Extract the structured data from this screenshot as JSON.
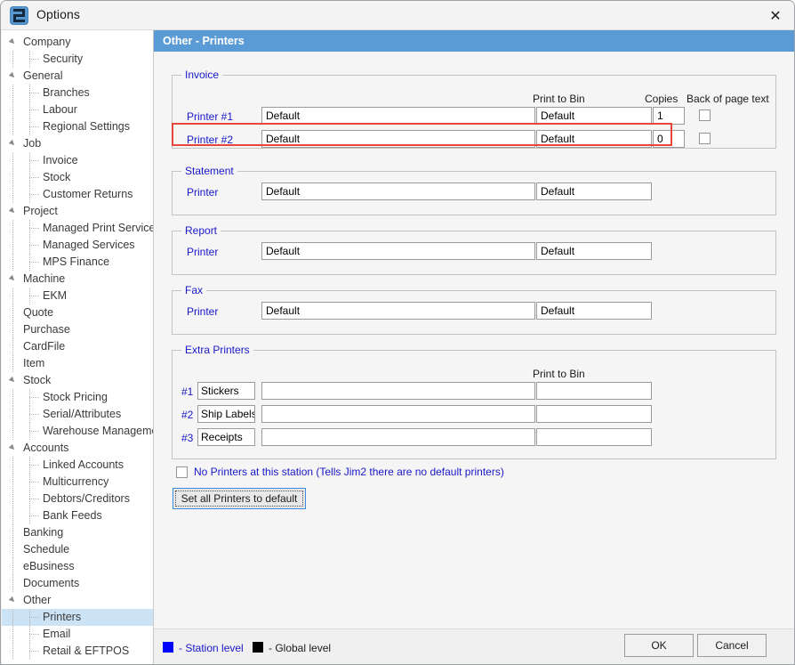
{
  "window": {
    "title": "Options",
    "app_icon": "jim2-logo-icon",
    "close_icon": "close-icon"
  },
  "page_header": {
    "title": "Other - Printers",
    "accent_color": "#5b9bd5"
  },
  "sidebar": {
    "items": [
      {
        "label": "Company",
        "level": 0,
        "expander": true,
        "selected": false
      },
      {
        "label": "Security",
        "level": 1,
        "expander": false,
        "selected": false
      },
      {
        "label": "General",
        "level": 0,
        "expander": true,
        "selected": false
      },
      {
        "label": "Branches",
        "level": 1,
        "expander": false,
        "selected": false
      },
      {
        "label": "Labour",
        "level": 1,
        "expander": false,
        "selected": false
      },
      {
        "label": "Regional Settings",
        "level": 1,
        "expander": false,
        "selected": false
      },
      {
        "label": "Job",
        "level": 0,
        "expander": true,
        "selected": false
      },
      {
        "label": "Invoice",
        "level": 1,
        "expander": false,
        "selected": false
      },
      {
        "label": "Stock",
        "level": 1,
        "expander": false,
        "selected": false
      },
      {
        "label": "Customer Returns",
        "level": 1,
        "expander": false,
        "selected": false
      },
      {
        "label": "Project",
        "level": 0,
        "expander": true,
        "selected": false
      },
      {
        "label": "Managed Print Services",
        "level": 1,
        "expander": false,
        "selected": false
      },
      {
        "label": "Managed Services",
        "level": 1,
        "expander": false,
        "selected": false
      },
      {
        "label": "MPS Finance",
        "level": 1,
        "expander": false,
        "selected": false
      },
      {
        "label": "Machine",
        "level": 0,
        "expander": true,
        "selected": false
      },
      {
        "label": "EKM",
        "level": 1,
        "expander": false,
        "selected": false
      },
      {
        "label": "Quote",
        "level": 0,
        "expander": false,
        "selected": false
      },
      {
        "label": "Purchase",
        "level": 0,
        "expander": false,
        "selected": false
      },
      {
        "label": "CardFile",
        "level": 0,
        "expander": false,
        "selected": false
      },
      {
        "label": "Item",
        "level": 0,
        "expander": false,
        "selected": false
      },
      {
        "label": "Stock",
        "level": 0,
        "expander": true,
        "selected": false
      },
      {
        "label": "Stock Pricing",
        "level": 1,
        "expander": false,
        "selected": false
      },
      {
        "label": "Serial/Attributes",
        "level": 1,
        "expander": false,
        "selected": false
      },
      {
        "label": "Warehouse Management",
        "level": 1,
        "expander": false,
        "selected": false
      },
      {
        "label": "Accounts",
        "level": 0,
        "expander": true,
        "selected": false
      },
      {
        "label": "Linked Accounts",
        "level": 1,
        "expander": false,
        "selected": false
      },
      {
        "label": "Multicurrency",
        "level": 1,
        "expander": false,
        "selected": false
      },
      {
        "label": "Debtors/Creditors",
        "level": 1,
        "expander": false,
        "selected": false
      },
      {
        "label": "Bank Feeds",
        "level": 1,
        "expander": false,
        "selected": false
      },
      {
        "label": "Banking",
        "level": 0,
        "expander": false,
        "selected": false
      },
      {
        "label": "Schedule",
        "level": 0,
        "expander": false,
        "selected": false
      },
      {
        "label": "eBusiness",
        "level": 0,
        "expander": false,
        "selected": false
      },
      {
        "label": "Documents",
        "level": 0,
        "expander": false,
        "selected": false
      },
      {
        "label": "Other",
        "level": 0,
        "expander": true,
        "selected": false
      },
      {
        "label": "Printers",
        "level": 1,
        "expander": false,
        "selected": true
      },
      {
        "label": "Email",
        "level": 1,
        "expander": false,
        "selected": false
      },
      {
        "label": "Retail & EFTPOS",
        "level": 1,
        "expander": false,
        "selected": false
      }
    ]
  },
  "invoice_group": {
    "legend": "Invoice",
    "col_print_to_bin": "Print to Bin",
    "col_copies": "Copies",
    "col_back_of_page_text": "Back of page text",
    "rows": [
      {
        "label": "Printer #1",
        "printer": "Default",
        "bin": "Default",
        "copies": "1",
        "back_of_page": false,
        "highlighted": false
      },
      {
        "label": "Printer #2",
        "printer": "Default",
        "bin": "Default",
        "copies": "0",
        "back_of_page": false,
        "highlighted": true
      }
    ],
    "highlight_color": "#e8453c"
  },
  "statement_group": {
    "legend": "Statement",
    "row": {
      "label": "Printer",
      "printer": "Default",
      "bin": "Default"
    }
  },
  "report_group": {
    "legend": "Report",
    "row": {
      "label": "Printer",
      "printer": "Default",
      "bin": "Default"
    }
  },
  "fax_group": {
    "legend": "Fax",
    "row": {
      "label": "Printer",
      "printer": "Default",
      "bin": "Default"
    }
  },
  "extra_printers_group": {
    "legend": "Extra Printers",
    "col_print_to_bin": "Print to Bin",
    "rows": [
      {
        "num": "#1",
        "name": "Stickers",
        "printer": "",
        "bin": ""
      },
      {
        "num": "#2",
        "name": "Ship Labels",
        "printer": "",
        "bin": ""
      },
      {
        "num": "#3",
        "name": "Receipts",
        "printer": "",
        "bin": ""
      }
    ]
  },
  "options": {
    "no_printers_label": "No Printers at this station (Tells Jim2 there are no default printers)",
    "no_printers_checked": false,
    "set_all_default_label": "Set all Printers to default"
  },
  "footer": {
    "legend_station_color": "#0000ff",
    "legend_station_text": "- Station level",
    "legend_global_color": "#000000",
    "legend_global_text": "- Global level",
    "ok_label": "OK",
    "cancel_label": "Cancel"
  }
}
